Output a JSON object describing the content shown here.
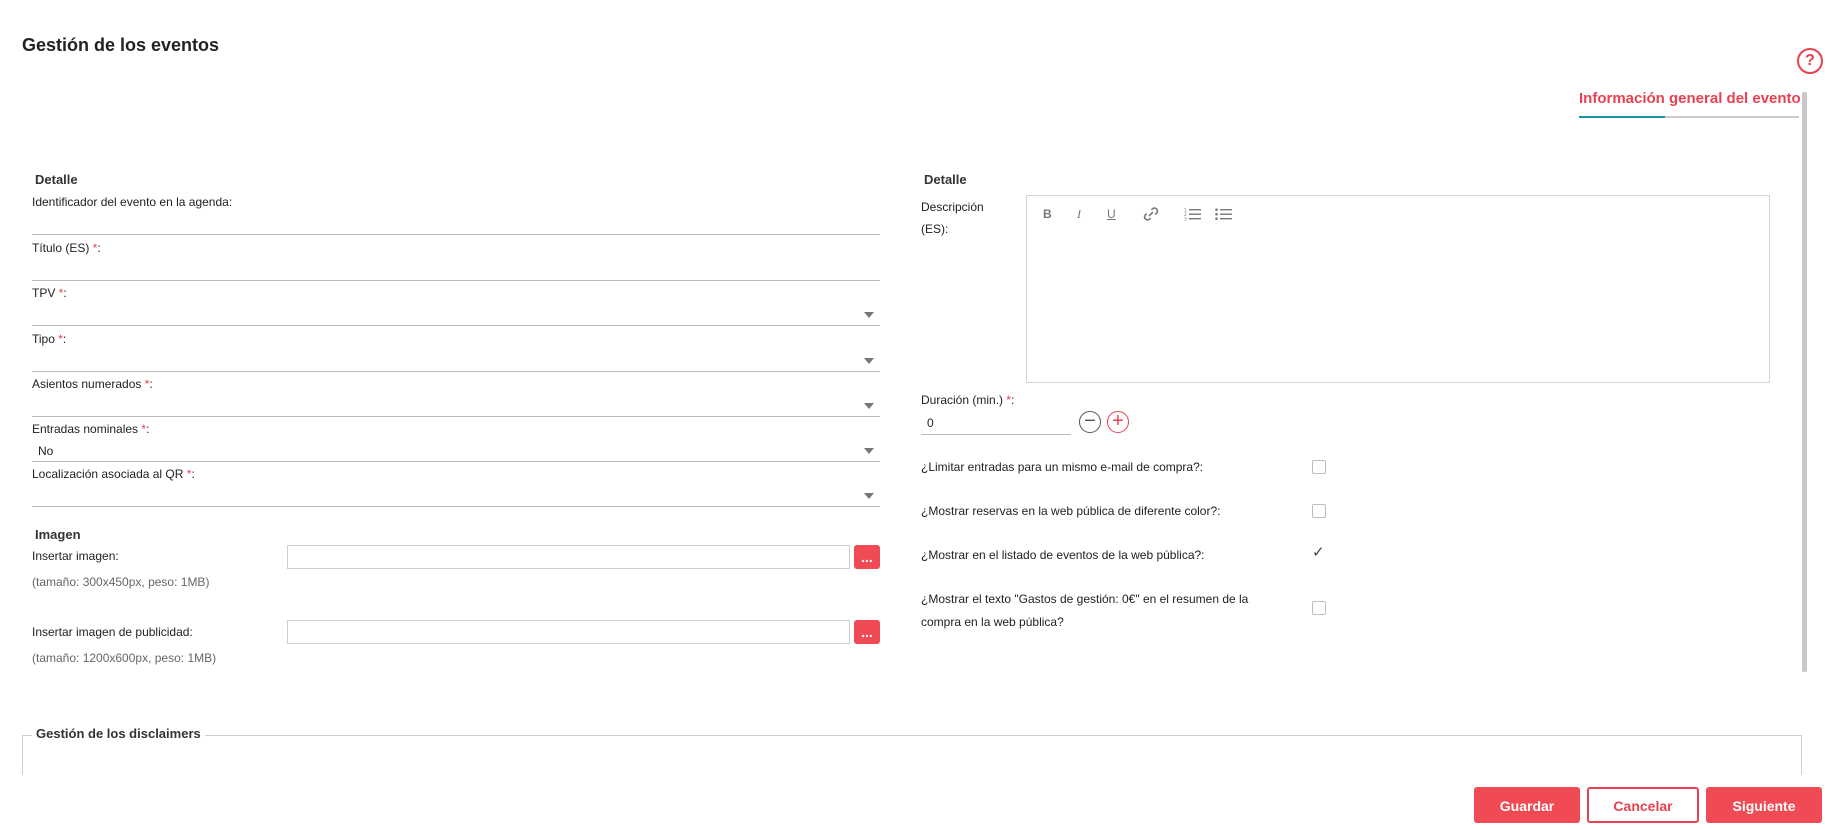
{
  "header": {
    "title": "Gestión de los eventos",
    "help_icon": "?"
  },
  "tabs": [
    {
      "label": "Información general del evento",
      "active": true
    }
  ],
  "left": {
    "section_detalle": "Detalle",
    "identificador": {
      "label": "Identificador del evento en la agenda:",
      "value": ""
    },
    "titulo": {
      "label": "Título (ES) ",
      "value": ""
    },
    "tpv": {
      "label": "TPV ",
      "value": ""
    },
    "tipo": {
      "label": "Tipo ",
      "value": ""
    },
    "asientos": {
      "label": "Asientos numerados ",
      "value": ""
    },
    "entradas": {
      "label": "Entradas nominales ",
      "value": "No"
    },
    "localizacion": {
      "label": "Localización asociada al QR ",
      "value": ""
    },
    "required_mark": "*",
    "colon": ":",
    "section_imagen": "Imagen",
    "imagen": {
      "label": "Insertar imagen:",
      "note": "(tamaño: 300x450px, peso: 1MB)",
      "button": "..."
    },
    "publicidad": {
      "label": "Insertar imagen de publicidad:",
      "note": "(tamaño: 1200x600px, peso: 1MB)",
      "button": "..."
    }
  },
  "right": {
    "section_detalle": "Detalle",
    "descripcion": {
      "label_line1": "Descripción",
      "label_line2": "(ES):"
    },
    "toolbar": {
      "bold": "B",
      "italic": "I",
      "underline": "U"
    },
    "duracion": {
      "label": "Duración (min.) ",
      "value": "0",
      "minus": "−",
      "plus": "+"
    },
    "checks": [
      {
        "label": "¿Limitar entradas para un mismo e-mail de compra?:",
        "checked": false
      },
      {
        "label": "¿Mostrar reservas en la web pública de diferente color?:",
        "checked": false
      },
      {
        "label": "¿Mostrar en el listado de eventos de la web pública?:",
        "checked": true
      },
      {
        "label_line1": "¿Mostrar el texto \"Gastos de gestión: 0€\" en el resumen de la",
        "label_line2": "compra en la web pública?",
        "checked": false
      }
    ],
    "check_glyph": "✓"
  },
  "disclaimers": {
    "legend": "Gestión de los disclaimers"
  },
  "footer": {
    "save": "Guardar",
    "cancel": "Cancelar",
    "next": "Siguiente"
  },
  "colors": {
    "accent": "#f04b55",
    "tab_active_line": "#1a94a6"
  }
}
